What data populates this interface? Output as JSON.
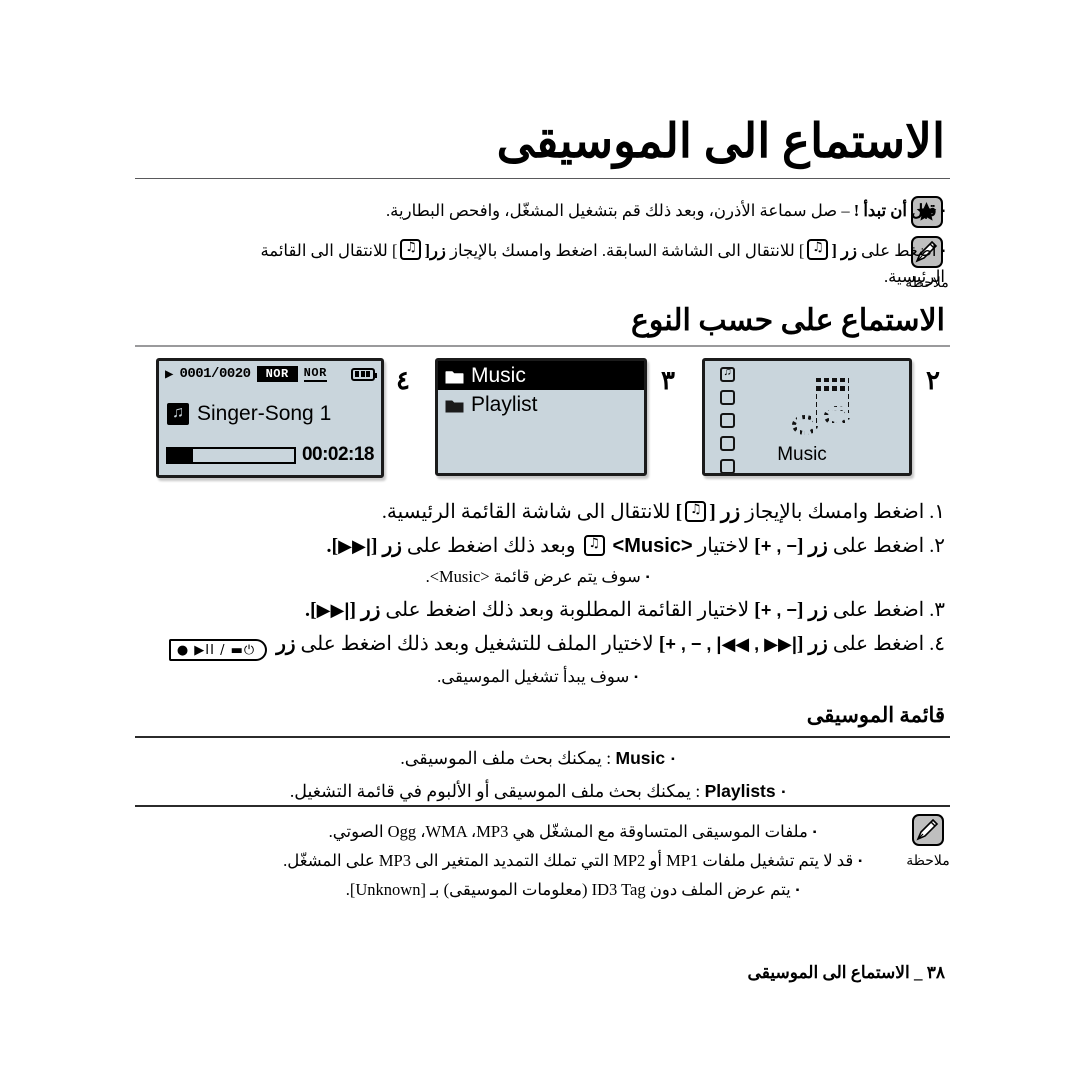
{
  "chapter": {
    "title": "الاستماع الى الموسيقى"
  },
  "top_notes": {
    "star_icon_name": "star-badge-icon",
    "note_icon_name": "note-pen-icon",
    "note_label": "ملاحظة",
    "bullet_glyph": "▪",
    "tip_before_label": "قبل أن تبدأ !",
    "tip_before_text": "– صل سماعة الأذرن، وبعد ذلك قم بتشغيل المشغّل، وافحص البطارية.",
    "tip_note_a": "اضغط على",
    "tip_note_key1": "زر [",
    "tip_note_key1_glyph": "⟲",
    "tip_note_b": "] للانتقال الى الشاشة السابقة. اضغط وامسك بالإيجاز",
    "tip_note_key2": "زر[",
    "tip_note_key2_glyph": "⟲",
    "tip_note_c": "] للانتقال الى القائمة الرئيسية."
  },
  "section": {
    "heading": "الاستماع على حسب النوع"
  },
  "screens": [
    {
      "number": "٢",
      "name": "music-splash-screen",
      "caption": "Music",
      "rail_items": 5,
      "rail_active_index": 0
    },
    {
      "number": "٣",
      "name": "music-menu-screen",
      "items": [
        {
          "label": "Music",
          "selected": true
        },
        {
          "label": "Playlist",
          "selected": false
        }
      ]
    },
    {
      "number": "٤",
      "name": "now-playing-screen",
      "play_glyph": "▶",
      "track_count": "0001/0020",
      "mode_badge_inverted": "NOR",
      "mode_badge_underlined": "NOR",
      "battery_icon": "battery-full-icon",
      "song_title": "Singer-Song 1",
      "progress_percent": 20,
      "elapsed_time": "00:02:18"
    }
  ],
  "steps": [
    {
      "num": "١.",
      "text_a": "اضغط وامسك بالإيجاز",
      "bold_a": "زر [",
      "key_glyph": "⟲",
      "bold_b": "]",
      "text_b": "للانتقال الى شاشة القائمة الرئيسية.",
      "sub": null
    },
    {
      "num": "٢.",
      "text_a": "اضغط على",
      "bold_a": "زر [",
      "keys": "+ , −",
      "bold_b": "]",
      "text_b": "لاختيار",
      "target": "<Music>",
      "chip": "music-note-chip-icon",
      "text_c": "وبعد ذلك اضغط على",
      "bold_c": "زر [",
      "keys2": "▶▶|",
      "bold_d": "].",
      "sub": "سوف يتم عرض قائمة <Music>."
    },
    {
      "num": "٣.",
      "text_a": "اضغط على",
      "bold_a": "زر [",
      "keys": "+ , −",
      "bold_b": "]",
      "text_b": "لاختيار القائمة المطلوبة وبعد ذلك اضغط على",
      "bold_c": "زر [",
      "keys2": "▶▶|",
      "bold_d": "].",
      "sub": null
    },
    {
      "num": "٤.",
      "text_a": "اضغط على",
      "bold_a": "زر [",
      "keys": "+ , − , |◀◀ , ▶▶|",
      "bold_b": "]",
      "text_b": "لاختيار الملف للتشغيل وبعد ذلك اضغط على",
      "bold_c": "زر",
      "playbtn": "● ▶II / ▬⏻",
      "sub": "سوف يبدأ تشغيل الموسيقى."
    }
  ],
  "music_list": {
    "heading": "قائمة الموسيقى",
    "bullet_glyph": "▪",
    "items": [
      {
        "name": "Music",
        "desc": ": يمكنك بحث ملف الموسيقى."
      },
      {
        "name": "Playlists",
        "desc": ": يمكنك بحث ملف الموسيقى أو الألبوم في قائمة التشغيل."
      }
    ]
  },
  "bottom_notes": {
    "note_icon_name": "note-pen-icon",
    "note_label": "ملاحظة",
    "bullet_glyph": "▪",
    "lines": [
      "ملفات الموسيقى المتساوقة مع المشغّل هي Ogg ،WMA ،MP3 الصوتي.",
      "قد لا يتم تشغيل ملفات MP1 أو MP2 التي تملك التمديد المتغير الى MP3 على المشغّل.",
      "يتم عرض الملف دون ID3 Tag (معلومات الموسيقى) بـ [Unknown]."
    ]
  },
  "footer": {
    "page_number": "٣٨",
    "separator": "_",
    "title": "الاستماع الى الموسيقى"
  },
  "colors": {
    "lcd_background": "#c9d5dc",
    "lcd_border": "#1b1b1b",
    "rule_heavy": "#59595b",
    "rule_mid": "#9a9a9c",
    "text": "#000000",
    "page_background": "#ffffff"
  }
}
